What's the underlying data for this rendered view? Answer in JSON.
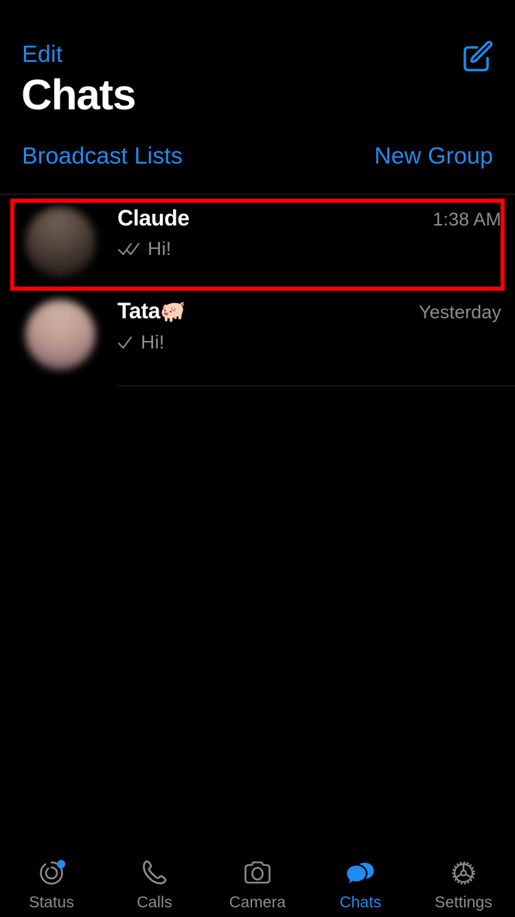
{
  "colors": {
    "background": "#000000",
    "accent": "#1e8cf0",
    "secondary_text": "#8d8d8f",
    "primary_text": "#ffffff",
    "highlight": "#ff0000",
    "separator": "#2a2a2a"
  },
  "navbar": {
    "edit_label": "Edit",
    "compose_icon": "compose-icon"
  },
  "header": {
    "title": "Chats"
  },
  "actions": {
    "broadcast_label": "Broadcast Lists",
    "new_group_label": "New Group"
  },
  "chats": [
    {
      "name": "Claude",
      "emoji": "",
      "preview": "Hi!",
      "time": "1:38 AM",
      "status_icon": "double-check-icon",
      "avatar_name": "avatar-claude",
      "highlighted": true
    },
    {
      "name": "Tata",
      "emoji": "🐖",
      "preview": "Hi!",
      "time": "Yesterday",
      "status_icon": "single-check-icon",
      "avatar_name": "avatar-tata",
      "highlighted": false
    }
  ],
  "tabbar": {
    "items": [
      {
        "label": "Status",
        "icon": "status-icon",
        "active": false,
        "badge": true
      },
      {
        "label": "Calls",
        "icon": "phone-icon",
        "active": false,
        "badge": false
      },
      {
        "label": "Camera",
        "icon": "camera-icon",
        "active": false,
        "badge": false
      },
      {
        "label": "Chats",
        "icon": "chats-icon",
        "active": true,
        "badge": false
      },
      {
        "label": "Settings",
        "icon": "gear-icon",
        "active": false,
        "badge": false
      }
    ]
  }
}
